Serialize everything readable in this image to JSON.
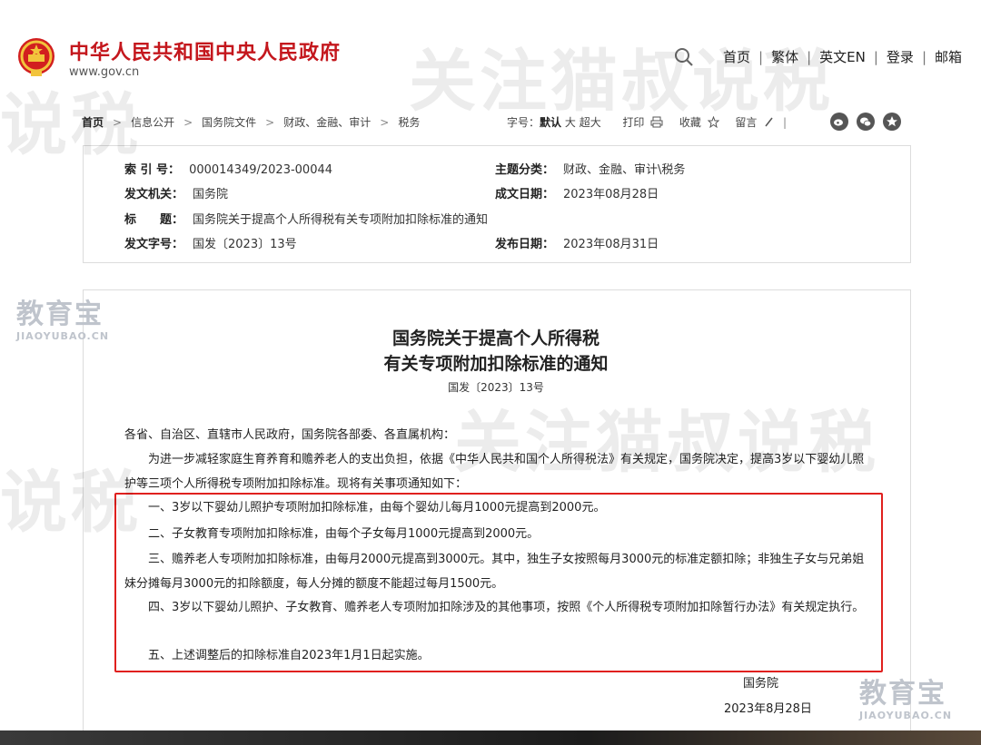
{
  "header": {
    "site_title": "中华人民共和国中央人民政府",
    "site_url": "www.gov.cn",
    "nav": [
      "首页",
      "繁体",
      "英文EN",
      "登录",
      "邮箱"
    ]
  },
  "breadcrumb": [
    "首页",
    "信息公开",
    "国务院文件",
    "财政、金融、审计",
    "税务"
  ],
  "tools": {
    "font_label": "字号：",
    "font_default": "默认",
    "font_large": "大",
    "font_xlarge": "超大",
    "print": "打印",
    "favorite": "收藏",
    "comment": "留言"
  },
  "meta": {
    "index_key": "索 引 号：",
    "index_val": "000014349/2023-00044",
    "topic_key": "主题分类：",
    "topic_val": "财政、金融、审计\\税务",
    "issuer_key": "发文机关：",
    "issuer_val": "国务院",
    "created_key": "成文日期：",
    "created_val": "2023年08月28日",
    "title_key": "标　　题：",
    "title_val": "国务院关于提高个人所得税有关专项附加扣除标准的通知",
    "docno_key": "发文字号：",
    "docno_val": "国发〔2023〕13号",
    "published_key": "发布日期：",
    "published_val": "2023年08月31日"
  },
  "document": {
    "title_line1": "国务院关于提高个人所得税",
    "title_line2": "有关专项附加扣除标准的通知",
    "doc_number": "国发〔2023〕13号",
    "salutation": "各省、自治区、直辖市人民政府，国务院各部委、各直属机构：",
    "intro": "为进一步减轻家庭生育养育和赡养老人的支出负担，依据《中华人民共和国个人所得税法》有关规定，国务院决定，提高3岁以下婴幼儿照护等三项个人所得税专项附加扣除标准。现将有关事项通知如下：",
    "item1": "一、3岁以下婴幼儿照护专项附加扣除标准，由每个婴幼儿每月1000元提高到2000元。",
    "item2": "二、子女教育专项附加扣除标准，由每个子女每月1000元提高到2000元。",
    "item3": "三、赡养老人专项附加扣除标准，由每月2000元提高到3000元。其中，独生子女按照每月3000元的标准定额扣除；非独生子女与兄弟姐妹分摊每月3000元的扣除额度，每人分摊的额度不能超过每月1500元。",
    "item4": "四、3岁以下婴幼儿照护、子女教育、赡养老人专项附加扣除涉及的其他事项，按照《个人所得税专项附加扣除暂行办法》有关规定执行。",
    "item5": "五、上述调整后的扣除标准自2023年1月1日起实施。",
    "signer": "国务院",
    "sign_date": "2023年8月28日"
  },
  "watermarks": {
    "text_a": "关注猫叔说税",
    "text_b": "说税",
    "brand_cn": "教育宝",
    "brand_en": "JIAOYUBAO.CN"
  },
  "colors": {
    "brand_red": "#c4171d",
    "highlight_red": "#e0201e"
  }
}
